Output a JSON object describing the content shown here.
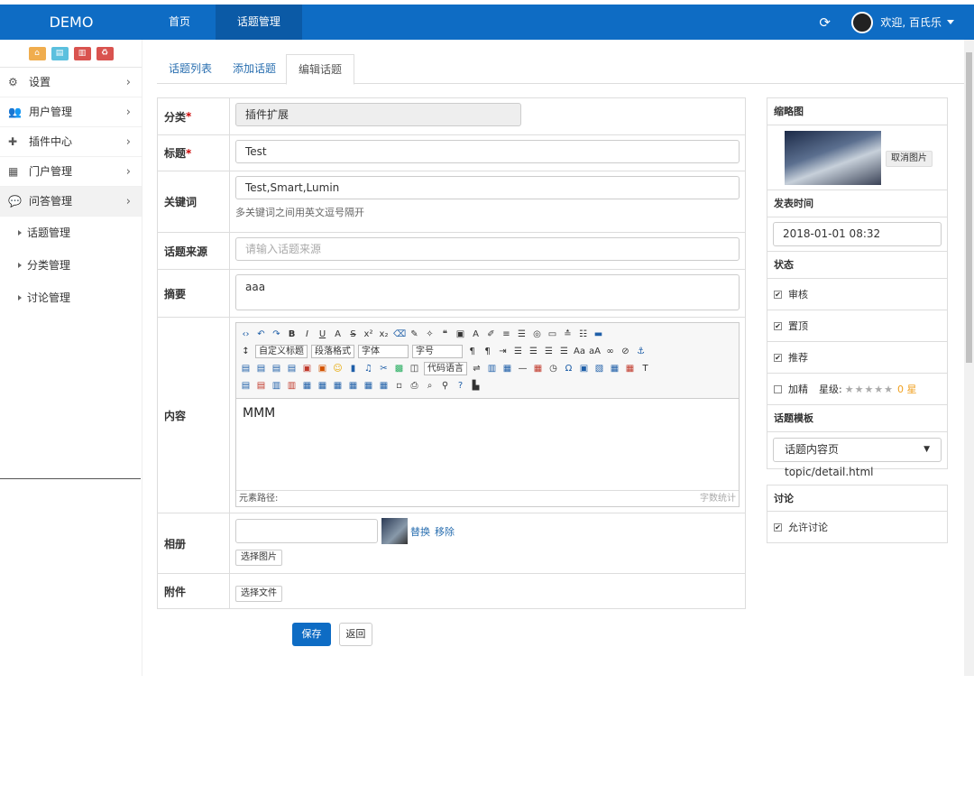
{
  "brand": "DEMO",
  "topnav": {
    "home": "首页",
    "topic_mgmt": "话题管理"
  },
  "user": {
    "welcome": "欢迎, 百氏乐"
  },
  "sidebar": {
    "items": [
      {
        "label": "设置"
      },
      {
        "label": "用户管理"
      },
      {
        "label": "插件中心"
      },
      {
        "label": "门户管理"
      },
      {
        "label": "问答管理"
      }
    ],
    "sub_items": [
      {
        "label": "话题管理"
      },
      {
        "label": "分类管理"
      },
      {
        "label": "讨论管理"
      }
    ]
  },
  "tabs": {
    "list": "话题列表",
    "add": "添加话题",
    "edit": "编辑话题"
  },
  "form": {
    "category": {
      "label": "分类",
      "value": "插件扩展"
    },
    "title": {
      "label": "标题",
      "value": "Test"
    },
    "keywords": {
      "label": "关键词",
      "value": "Test,Smart,Lumin",
      "help": "多关键词之间用英文逗号隔开"
    },
    "source": {
      "label": "话题来源",
      "placeholder": "请输入话题来源"
    },
    "summary": {
      "label": "摘要",
      "value": "aaa"
    },
    "content": {
      "label": "内容",
      "value": "MMM",
      "toolbar": {
        "custom_title": "自定义标题",
        "para_format": "段落格式",
        "font": "字体",
        "size": "字号",
        "code_lang": "代码语言"
      },
      "footer_path": "元素路径:",
      "footer_count": "字数统计"
    },
    "album": {
      "label": "相册",
      "replace": "替换",
      "remove": "移除",
      "choose": "选择图片"
    },
    "attachment": {
      "label": "附件",
      "choose": "选择文件"
    }
  },
  "actions": {
    "save": "保存",
    "back": "返回"
  },
  "right": {
    "thumb_title": "缩略图",
    "cancel_image": "取消图片",
    "publish_time_title": "发表时间",
    "publish_time": "2018-01-01 08:32",
    "status_title": "状态",
    "status": {
      "review": "审核",
      "top": "置顶",
      "recommend": "推荐",
      "featured": "加精",
      "stars_label": "星级:",
      "stars_value": "0 星"
    },
    "template_title": "话题模板",
    "template_value": "话题内容页 topic/detail.html",
    "discuss_title": "讨论",
    "allow_discuss": "允许讨论"
  },
  "colors": {
    "primary": "#0e6cc4",
    "topbar": "#0e6cc4"
  }
}
